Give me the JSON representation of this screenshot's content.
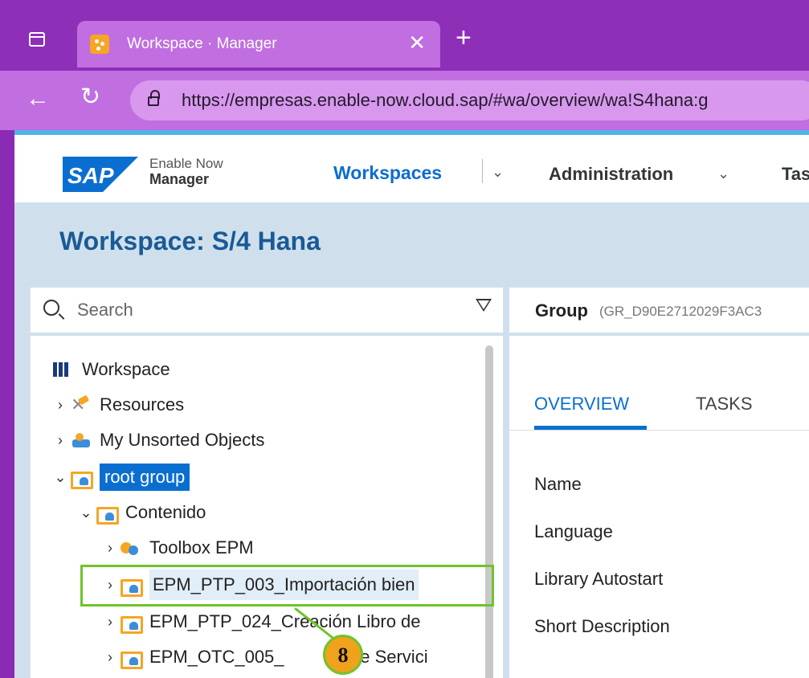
{
  "browser": {
    "tab_title": "Workspace · Manager",
    "tab_close": "✕",
    "new_tab": "+",
    "back": "←",
    "reload": "↻",
    "url": "https://empresas.enable-now.cloud.sap/#wa/overview/wa!S4hana:g"
  },
  "header": {
    "logo_text": "SAP",
    "brand_line1": "Enable Now",
    "brand_line2": "Manager",
    "nav": {
      "workspaces": "Workspaces",
      "administration": "Administration",
      "tasks": "Tas"
    }
  },
  "page": {
    "title": "Workspace: S/4 Hana"
  },
  "search": {
    "placeholder": "Search"
  },
  "tree": {
    "items": [
      {
        "label": "Workspace",
        "icon": "workspace-icon"
      },
      {
        "label": "Resources",
        "icon": "resources-icon"
      },
      {
        "label": "My Unsorted Objects",
        "icon": "unsorted-icon"
      },
      {
        "label": "root group",
        "icon": "folder-icon"
      },
      {
        "label": "Contenido",
        "icon": "folder-icon"
      },
      {
        "label": "Toolbox EPM",
        "icon": "toolbox-icon"
      },
      {
        "label": "EPM_PTP_003_Importación bien",
        "icon": "folder-icon"
      },
      {
        "label": "EPM_PTP_024_Creación Libro de",
        "icon": "folder-icon"
      },
      {
        "label": "EPM_OTC_005_",
        "icon": "folder-icon"
      },
      {
        "label": "ta de Servici",
        "icon": "folder-icon"
      }
    ]
  },
  "callout": {
    "step": "8",
    "color": "#6fc42b"
  },
  "detail": {
    "type_label": "Group",
    "group_id": "(GR_D90E2712029F3AC3",
    "tabs": [
      "OVERVIEW",
      "TASKS"
    ],
    "fields": [
      "Name",
      "Language",
      "Library Autostart",
      "Short Description"
    ]
  },
  "colors": {
    "accent": "#0a6ed1",
    "browser": "#8e2fb8"
  }
}
